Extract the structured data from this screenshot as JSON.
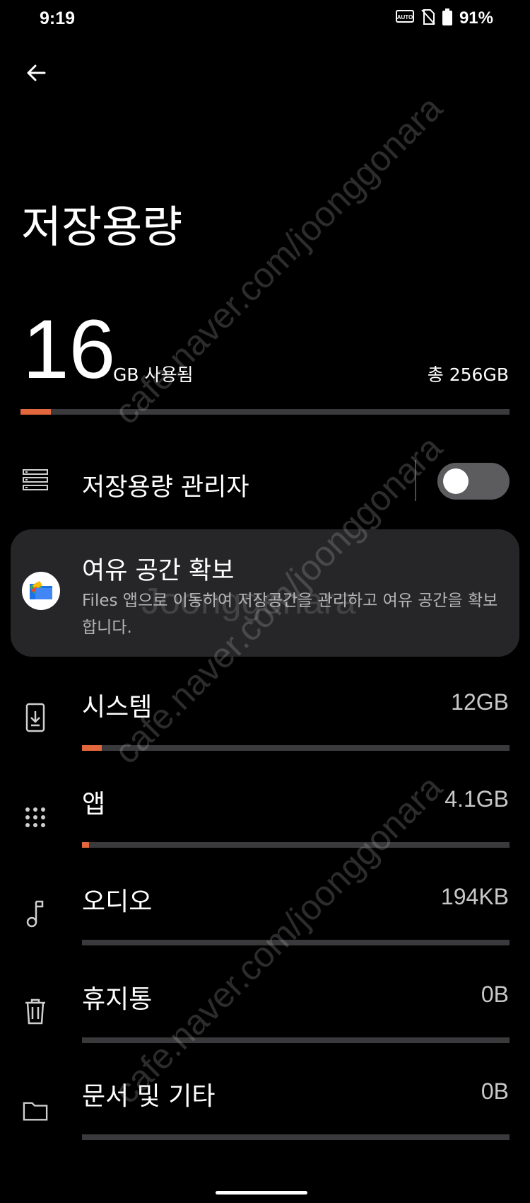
{
  "status_bar": {
    "time": "9:19",
    "battery": "91%",
    "icons": [
      "auto-brightness-icon",
      "no-sim-icon",
      "battery-icon"
    ]
  },
  "header": {
    "back_icon": "back-arrow-icon",
    "title": "저장용량"
  },
  "summary": {
    "used_value": "16",
    "used_unit": "GB 사용됨",
    "total": "총 256GB",
    "used_fraction": 0.0625
  },
  "manager": {
    "label": "저장용량 관리자",
    "icon": "storage-list-icon",
    "toggle_on": false
  },
  "freeup": {
    "title": "여유 공간 확보",
    "description": "Files 앱으로 이동하여 저장공간을 관리하고 여유 공간을 확보합니다.",
    "icon": "files-app-icon"
  },
  "categories": [
    {
      "label": "시스템",
      "size": "12GB",
      "icon": "system-update-icon",
      "fraction": 0.047
    },
    {
      "label": "앱",
      "size": "4.1GB",
      "icon": "apps-grid-icon",
      "fraction": 0.016
    },
    {
      "label": "오디오",
      "size": "194KB",
      "icon": "music-note-icon",
      "fraction": 0
    },
    {
      "label": "휴지통",
      "size": "0B",
      "icon": "trash-icon",
      "fraction": 0
    },
    {
      "label": "문서 및 기타",
      "size": "0B",
      "icon": "folder-icon",
      "fraction": 0
    }
  ],
  "watermark": {
    "text": "cafe.naver.com/joonggonara",
    "text2": "Joonggonara"
  },
  "colors": {
    "accent": "#e2673c",
    "track": "#3a3a3c",
    "card": "#262628",
    "background": "#000000"
  }
}
